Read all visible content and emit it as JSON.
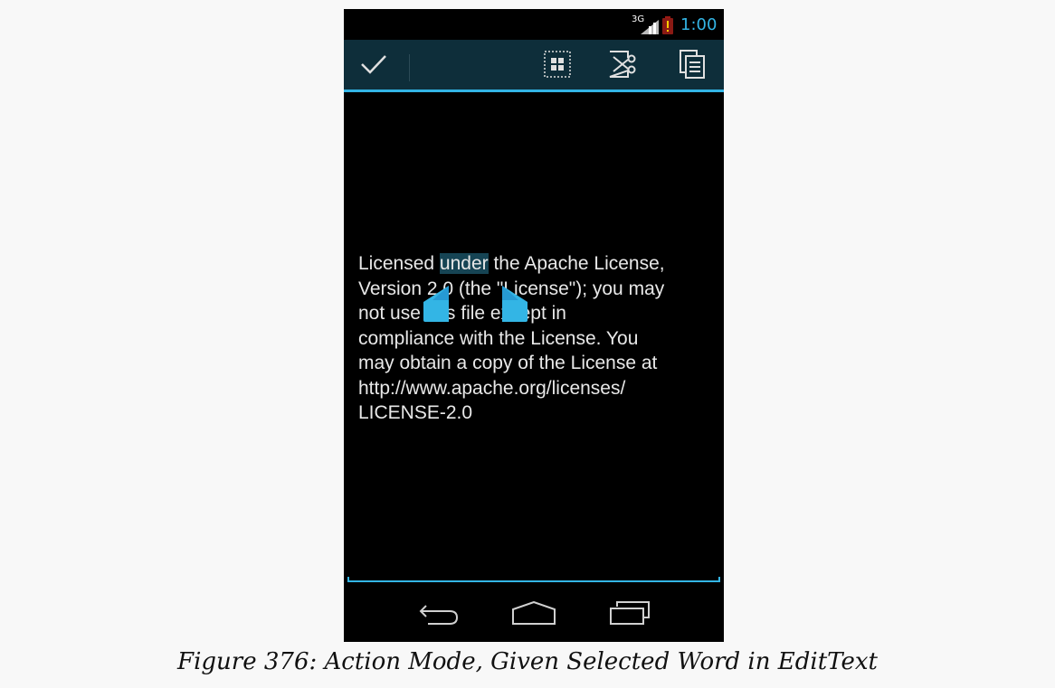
{
  "status_bar": {
    "network": "3G",
    "time": "1:00",
    "signal_icon": "signal-bars-icon",
    "battery_icon": "battery-low-icon",
    "accent_color": "#33b5e5"
  },
  "action_bar": {
    "done_icon": "checkmark-icon",
    "select_all_icon": "select-all-icon",
    "cut_icon": "scissors-icon",
    "copy_icon": "copy-icon",
    "background_color": "#0e2e3a"
  },
  "edit_text": {
    "lines": [
      {
        "before": "Licensed ",
        "selected": "under",
        "after": " the Apache License,"
      },
      {
        "text": "Version 2.0 (the \"License\"); you may"
      },
      {
        "text": "not use this file except in"
      },
      {
        "text": "compliance with the License. You"
      },
      {
        "text": "may obtain a copy of the License at"
      },
      {
        "text": "http://www.apache.org/licenses/"
      },
      {
        "text": "LICENSE-2.0"
      }
    ],
    "selection_color": "#164454"
  },
  "nav_bar": {
    "back_icon": "back-arrow-icon",
    "home_icon": "home-icon",
    "recent_icon": "recent-apps-icon"
  },
  "caption": "Figure 376: Action Mode, Given Selected Word in EditText"
}
